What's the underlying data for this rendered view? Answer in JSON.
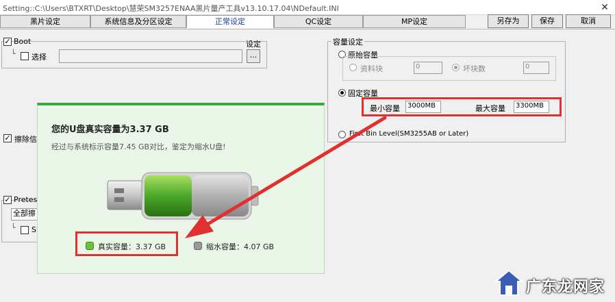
{
  "window": {
    "title": "Setting::C:\\Users\\BTXRT\\Desktop\\慧荣SM3257ENAA黑片量产工具v13.10.17.04\\NDefault.INI",
    "close_glyph": "✕"
  },
  "tabs": [
    {
      "label": "黑片设定"
    },
    {
      "label": "系统信息及分区设定"
    },
    {
      "label": "正常设定"
    },
    {
      "label": "QC设定"
    },
    {
      "label": "MP设定"
    }
  ],
  "buttons": {
    "save_as": "另存为",
    "save": "保存",
    "cancel": "取消"
  },
  "boot": {
    "label": "Boot",
    "select_label": "选择",
    "setting_label": "设定",
    "browse_label": "...",
    "tree_glyph": "└"
  },
  "erase": {
    "label": "擦除信"
  },
  "pretest": {
    "label": "Pretest",
    "field_value": "全部擦",
    "sub_label": "S"
  },
  "capacity": {
    "group_title": "容量设定",
    "original": {
      "label": "原始容量",
      "resource_block_label": "资料块",
      "resource_block_value": "0",
      "bad_block_label": "坏块数",
      "bad_block_value": "0"
    },
    "fixed": {
      "label": "固定容量",
      "min_label": "最小容量",
      "min_value": "3000MB",
      "max_label": "最大容量",
      "max_value": "3300MB"
    },
    "first_bin_label": "First Bin Level(SM3255AB or Later)"
  },
  "popup": {
    "title": "您的U盘真实容量为3.37 GB",
    "subtitle": "经过与系统标示容量7.45 GB对比，鉴定为缩水U盘!",
    "real_capacity_label": "真实容量：3.37 GB",
    "shrunk_capacity_label": "缩水容量：4.07 GB",
    "real_fraction": 0.452,
    "colors": {
      "real": "#4aa82a",
      "shrunk": "#a8a8a8"
    }
  },
  "watermark": {
    "text": "广东龙网家"
  },
  "colors": {
    "highlight": "#e03030",
    "accent_green": "#3aa83a",
    "active_tab_text": "#1a3c9e"
  }
}
